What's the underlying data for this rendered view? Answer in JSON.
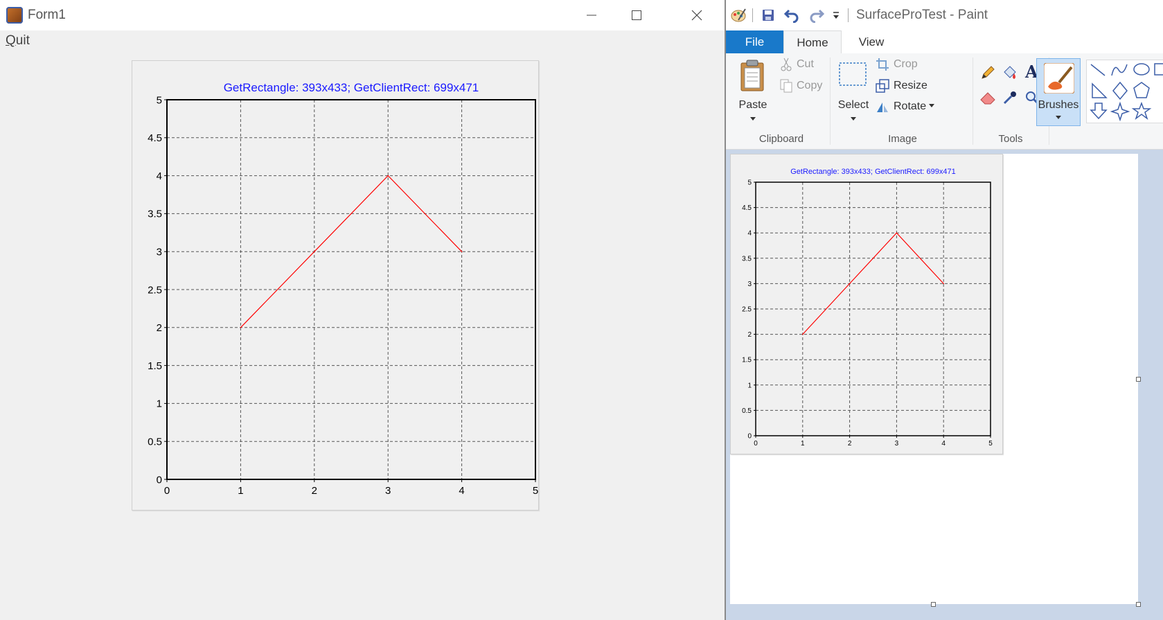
{
  "form1": {
    "title": "Form1",
    "menu": {
      "quit": "Quit"
    },
    "chart": {
      "title": "GetRectangle: 393x433; GetClientRect: 699x471",
      "colors": {
        "title": "#1a1aff",
        "series": "#ff0000",
        "grid": "#555555",
        "background": "#f0f0f0"
      }
    }
  },
  "paint": {
    "window_title": "SurfaceProTest - Paint",
    "tabs": [
      "File",
      "Home",
      "View"
    ],
    "clipboard": {
      "paste": "Paste",
      "cut": "Cut",
      "copy": "Copy",
      "group": "Clipboard"
    },
    "image": {
      "select": "Select",
      "crop": "Crop",
      "resize": "Resize",
      "rotate": "Rotate",
      "group": "Image"
    },
    "tools": {
      "group": "Tools"
    },
    "brushes": {
      "label": "Brushes"
    },
    "icons": [
      "paint-app-icon",
      "save-icon",
      "undo-icon",
      "redo-icon",
      "customize-qa-icon",
      "cut-icon",
      "copy-icon",
      "paste-icon",
      "select-icon",
      "crop-icon",
      "resize-icon",
      "rotate-icon",
      "pencil-icon",
      "fill-icon",
      "text-icon",
      "eraser-icon",
      "color-picker-icon",
      "magnifier-icon",
      "brushes-icon",
      "line-shape-icon",
      "curve-shape-icon",
      "oval-shape-icon",
      "rectangle-shape-icon",
      "triangle-shape-icon",
      "diamond-shape-icon",
      "pentagon-shape-icon",
      "arrow-down-shape-icon",
      "star4-shape-icon",
      "star5-shape-icon"
    ]
  },
  "chart_data": [
    {
      "type": "line",
      "title": "GetRectangle: 393x433; GetClientRect: 699x471",
      "xlabel": "",
      "ylabel": "",
      "xlim": [
        0,
        5
      ],
      "ylim": [
        0,
        5
      ],
      "x_ticks": [
        "0",
        "1",
        "2",
        "3",
        "4",
        "5"
      ],
      "y_ticks": [
        "0",
        "0.5",
        "1",
        "1.5",
        "2",
        "2.5",
        "3",
        "3.5",
        "4",
        "4.5",
        "5"
      ],
      "grid": true,
      "series": [
        {
          "x": [
            1,
            2,
            3,
            4
          ],
          "y": [
            2,
            3,
            4,
            3
          ],
          "color": "#ff0000"
        }
      ]
    },
    {
      "type": "line",
      "title": "GetRectangle: 393x433; GetClientRect: 699x471",
      "xlabel": "",
      "ylabel": "",
      "xlim": [
        0,
        5
      ],
      "ylim": [
        0,
        5
      ],
      "x_ticks": [
        "0",
        "1",
        "2",
        "3",
        "4",
        "5"
      ],
      "y_ticks": [
        "0",
        "0.5",
        "1",
        "1.5",
        "2",
        "2.5",
        "3",
        "3.5",
        "4",
        "4.5",
        "5"
      ],
      "grid": true,
      "series": [
        {
          "x": [
            1,
            2,
            3,
            4
          ],
          "y": [
            2,
            3,
            4,
            3
          ],
          "color": "#ff0000"
        }
      ]
    }
  ]
}
